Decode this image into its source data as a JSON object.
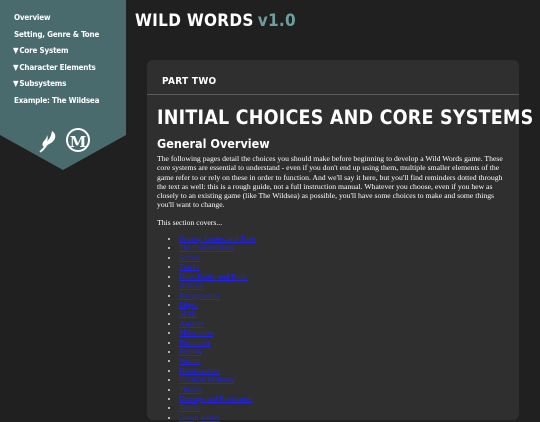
{
  "site": {
    "title": "WILD WORDS",
    "version": "v1.0"
  },
  "sidebar": {
    "items": [
      {
        "label": "Overview",
        "caret": ""
      },
      {
        "label": "Setting, Genre & Tone",
        "caret": ""
      },
      {
        "label": "Core System",
        "caret": "▼"
      },
      {
        "label": "Character Elements",
        "caret": "▼"
      },
      {
        "label": "Subsystems",
        "caret": "▼"
      },
      {
        "label": "Example: The Wildsea",
        "caret": ""
      }
    ],
    "logos": {
      "left": "feather-quill-logo",
      "right_letter": "M"
    },
    "color": "#4a6b6e"
  },
  "main": {
    "part": "PART TWO",
    "title": "INITIAL CHOICES AND CORE SYSTEMS",
    "section": "General Overview",
    "intro": "The following pages detail the choices you should make before beginning to develop a Wild Words game. These core systems are essential to understand - even if you don't end up using them, multiple smaller elements of the game refer to or rely on these in order to function. And we'll say it here, but you'll find reminders dotted through the text as well: this is a rough guide, not a full instruction manual. Whatever you choose, even if you hew as closely to an existing game (like The Wildsea) as possible, you'll have some choices to make and some things you'll want to change.",
    "covers_intro": "This section covers...",
    "covers": [
      "Setting, Genre, and Tone",
      "The Conversation",
      "Scenes",
      "Tracks",
      "Dice, Pools, and Rolls",
      "Actions",
      "Backgrounds",
      "Edges",
      "Skills",
      "Aspects",
      "Milestones",
      "Resources",
      "Burden",
      "Wealth",
      "Deterioration",
      "Creation Methods",
      "Threats",
      "Damage and Resistance",
      "Tempo",
      "Group Assets"
    ]
  },
  "colors": {
    "background": "#202020",
    "card": "#2f2f2f",
    "accent": "#6f9ea0",
    "link": "#2222ee"
  }
}
